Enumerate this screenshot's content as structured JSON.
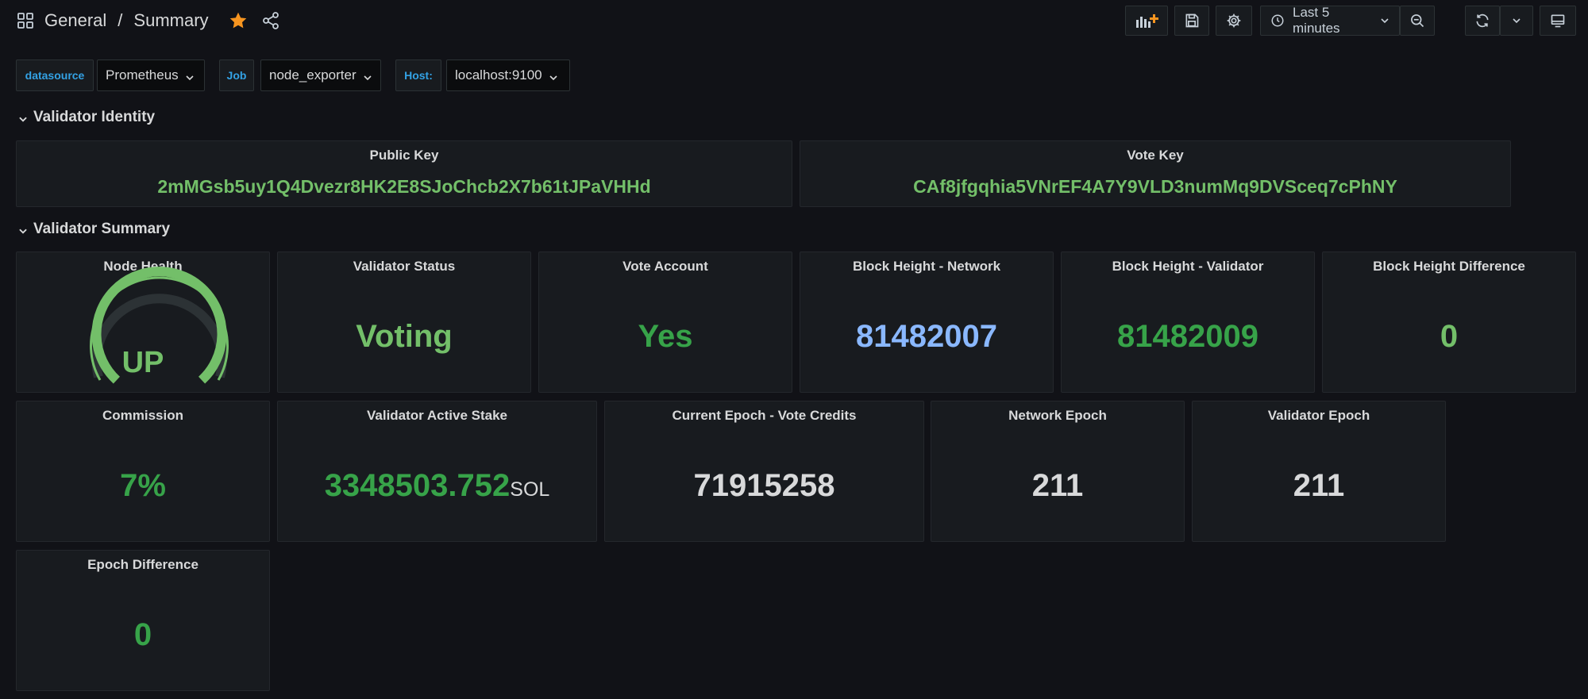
{
  "header": {
    "breadcrumb": [
      "General",
      "Summary"
    ],
    "separator": "/",
    "time_range": "Last 5 minutes"
  },
  "icons": {
    "apps": "apps-grid-icon",
    "star": "star-icon",
    "share": "share-icon",
    "add_panel": "add-panel-icon",
    "save": "save-icon",
    "settings": "gear-icon",
    "clock": "clock-icon",
    "zoom_out": "zoom-out-icon",
    "refresh": "refresh-icon",
    "tv": "tv-mode-icon"
  },
  "colors": {
    "background": "#111217",
    "panel": "#181b1f",
    "star": "#f79520",
    "green": "#73bf69",
    "dark_green": "#37a349",
    "blue": "#8ab8ff",
    "variable_label": "#33a2e5"
  },
  "variables": [
    {
      "label": "datasource",
      "value": "Prometheus"
    },
    {
      "label": "Job",
      "value": "node_exporter"
    },
    {
      "label": "Host:",
      "value": "localhost:9100"
    }
  ],
  "rows": {
    "identity": "Validator Identity",
    "summary": "Validator Summary"
  },
  "identity": {
    "public_key": {
      "title": "Public Key",
      "value": "2mMGsb5uy1Q4Dvezr8HK2E8SJoChcb2X7b61tJPaVHHd"
    },
    "vote_key": {
      "title": "Vote Key",
      "value": "CAf8jfgqhia5VNrEF4A7Y9VLD3numMq9DVSceq7cPhNY"
    }
  },
  "panels": {
    "node_health": {
      "title": "Node Health",
      "value": "UP",
      "gauge_fraction": 1.0
    },
    "validator_status": {
      "title": "Validator Status",
      "value": "Voting"
    },
    "vote_account": {
      "title": "Vote Account",
      "value": "Yes"
    },
    "block_height_network": {
      "title": "Block Height - Network",
      "value": "81482007"
    },
    "block_height_validator": {
      "title": "Block Height - Validator",
      "value": "81482009"
    },
    "block_height_difference": {
      "title": "Block Height Difference",
      "value": "0"
    },
    "commission": {
      "title": "Commission",
      "value": "7%"
    },
    "active_stake": {
      "title": "Validator Active Stake",
      "value": "3348503.752",
      "unit": "SOL"
    },
    "vote_credits": {
      "title": "Current Epoch - Vote Credits",
      "value": "71915258"
    },
    "network_epoch": {
      "title": "Network Epoch",
      "value": "211"
    },
    "validator_epoch": {
      "title": "Validator Epoch",
      "value": "211"
    },
    "epoch_difference": {
      "title": "Epoch Difference",
      "value": "0"
    }
  }
}
